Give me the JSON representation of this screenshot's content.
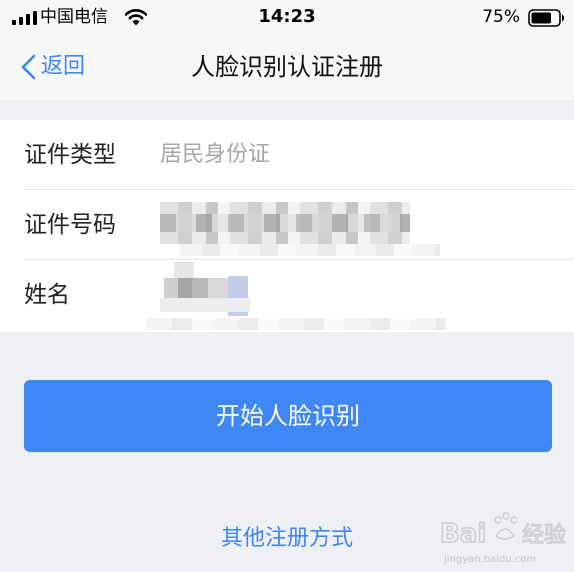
{
  "status_bar": {
    "carrier": "中国电信",
    "time": "14:23",
    "battery_percent": "75%",
    "battery_level": 0.75,
    "icons": [
      "signal-icon",
      "wifi-icon",
      "battery-icon"
    ]
  },
  "nav": {
    "back_label": "返回",
    "title": "人脸识别认证注册",
    "back_icon": "chevron-left-icon"
  },
  "form": {
    "rows": [
      {
        "label": "证件类型",
        "value": "居民身份证"
      },
      {
        "label": "证件号码",
        "value": ""
      },
      {
        "label": "姓名",
        "value": ""
      }
    ]
  },
  "actions": {
    "start_label": "开始人脸识别",
    "other_methods_label": "其他注册方式"
  },
  "colors": {
    "accent": "#3f86f1",
    "button_bg": "#3f87f4",
    "page_bg": "#eff0f4",
    "placeholder_text": "#a5a7ad"
  }
}
